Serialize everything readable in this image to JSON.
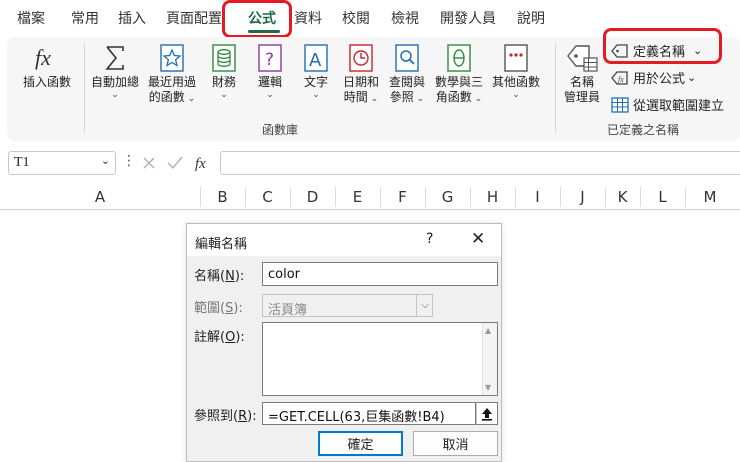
{
  "tabs": [
    {
      "label": "檔案",
      "active": false
    },
    {
      "label": "常用",
      "active": false
    },
    {
      "label": "插入",
      "active": false
    },
    {
      "label": "頁面配置",
      "active": false
    },
    {
      "label": "公式",
      "active": true
    },
    {
      "label": "資料",
      "active": false
    },
    {
      "label": "校閱",
      "active": false
    },
    {
      "label": "檢視",
      "active": false
    },
    {
      "label": "開發人員",
      "active": false
    },
    {
      "label": "說明",
      "active": false
    }
  ],
  "ribbon": {
    "insert_function": {
      "label": "插入函數",
      "icon": "fx-icon"
    },
    "function_library": {
      "group_label": "函數庫",
      "buttons": [
        {
          "line1": "自動加總",
          "line2": "",
          "icon": "sigma-icon"
        },
        {
          "line1": "最近用過",
          "line2": "的函數",
          "icon": "star-icon"
        },
        {
          "line1": "財務",
          "line2": "",
          "icon": "database-icon"
        },
        {
          "line1": "邏輯",
          "line2": "",
          "icon": "question-icon"
        },
        {
          "line1": "文字",
          "line2": "",
          "icon": "text-a-icon"
        },
        {
          "line1": "日期和",
          "line2": "時間",
          "icon": "clock-icon"
        },
        {
          "line1": "查閱與",
          "line2": "參照",
          "icon": "magnifier-icon"
        },
        {
          "line1": "數學與三",
          "line2": "角函數",
          "icon": "theta-icon"
        },
        {
          "line1": "其他函數",
          "line2": "",
          "icon": "more-dots-icon"
        }
      ]
    },
    "defined_names": {
      "group_label": "已定義之名稱",
      "name_manager": {
        "line1": "名稱",
        "line2": "管理員",
        "icon": "tag-table-icon"
      },
      "define_name": "定義名稱",
      "use_in_formula": "用於公式",
      "create_from_selection": "從選取範圍建立"
    }
  },
  "formula_bar": {
    "name_box": "T1",
    "formula": ""
  },
  "columns": [
    "A",
    "B",
    "C",
    "D",
    "E",
    "F",
    "G",
    "H",
    "I",
    "J",
    "K",
    "L",
    "M"
  ],
  "dialog": {
    "title": "編輯名稱",
    "help": "?",
    "close": "✕",
    "name_label": "名稱(N):",
    "name_value": "color",
    "scope_label": "範圍(S):",
    "scope_value": "活頁簿",
    "comment_label": "註解(O):",
    "comment_value": "",
    "refers_label": "參照到(R):",
    "refers_value": "=GET.CELL(63,巨集函數!B4)",
    "ok": "確定",
    "cancel": "取消"
  },
  "colors": {
    "accent_green": "#1e6b43",
    "highlight_red": "#e31c23",
    "ok_border": "#0078d4"
  }
}
